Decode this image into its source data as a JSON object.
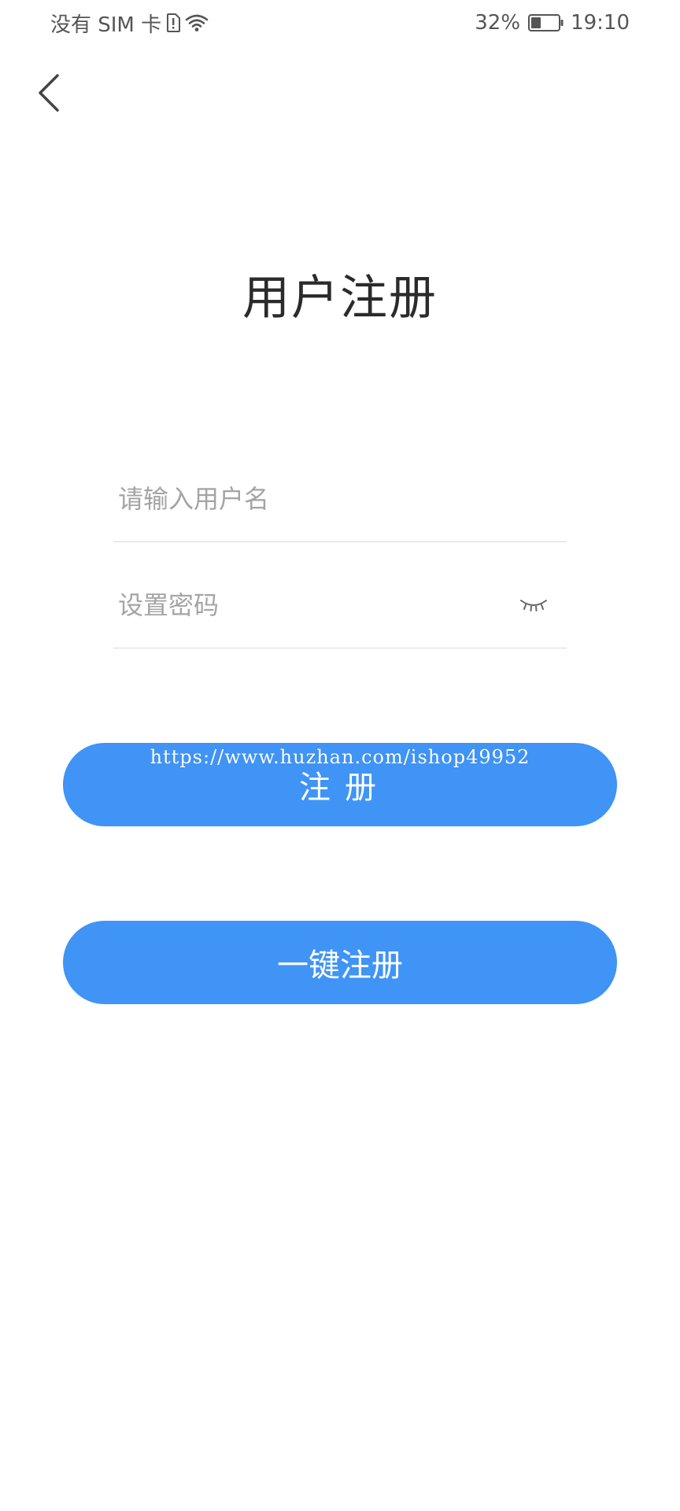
{
  "status_bar": {
    "carrier": "没有 SIM 卡",
    "battery_percent": "32%",
    "time": "19:10",
    "icons": [
      "sim-alert-icon",
      "wifi-icon",
      "battery-icon"
    ]
  },
  "header": {
    "back_icon": "chevron-left-icon"
  },
  "title": "用户注册",
  "form": {
    "username": {
      "value": "",
      "placeholder": "请输入用户名"
    },
    "password": {
      "value": "",
      "placeholder": "设置密码",
      "toggle_icon": "eye-closed-icon"
    }
  },
  "buttons": {
    "register_label": "注册",
    "one_click_register_label": "一键注册"
  },
  "watermark": "https://www.huzhan.com/ishop49952",
  "colors": {
    "primary": "#3f94f5",
    "text": "#2b2b2b",
    "placeholder": "#a4a4a4",
    "divider": "#dcdcdc"
  }
}
